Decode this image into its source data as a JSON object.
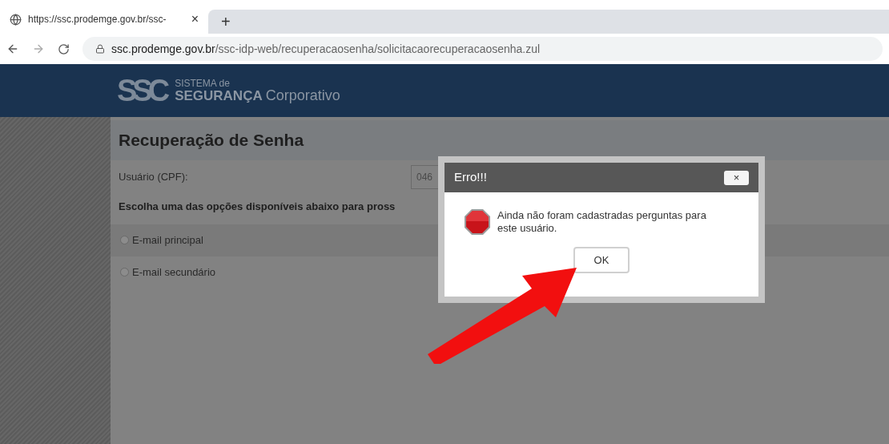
{
  "browser": {
    "tab": {
      "title": "https://ssc.prodemge.gov.br/ssc-",
      "close": "×"
    },
    "new_tab": "+",
    "url_host": "ssc.prodemge.gov.br",
    "url_path": "/ssc-idp-web/recuperacaosenha/solicitacaorecuperacaosenha.zul"
  },
  "header": {
    "logo_mark": "SSC",
    "logo_line1": "SISTEMA de",
    "logo_line2": "SEGURANÇA",
    "logo_word": "Corporativo"
  },
  "page": {
    "title": "Recuperação de Senha",
    "user_label": "Usuário (CPF):",
    "user_value": "046",
    "instruction": "Escolha uma das opções disponíveis abaixo para pross",
    "options": [
      {
        "label": "E-mail principal",
        "selected": false
      },
      {
        "label": "E-mail secundário",
        "selected": false
      }
    ]
  },
  "dialog": {
    "title": "Erro!!!",
    "close": "×",
    "message": "Ainda não foram cadastradas perguntas para este usuário.",
    "button": "OK"
  }
}
